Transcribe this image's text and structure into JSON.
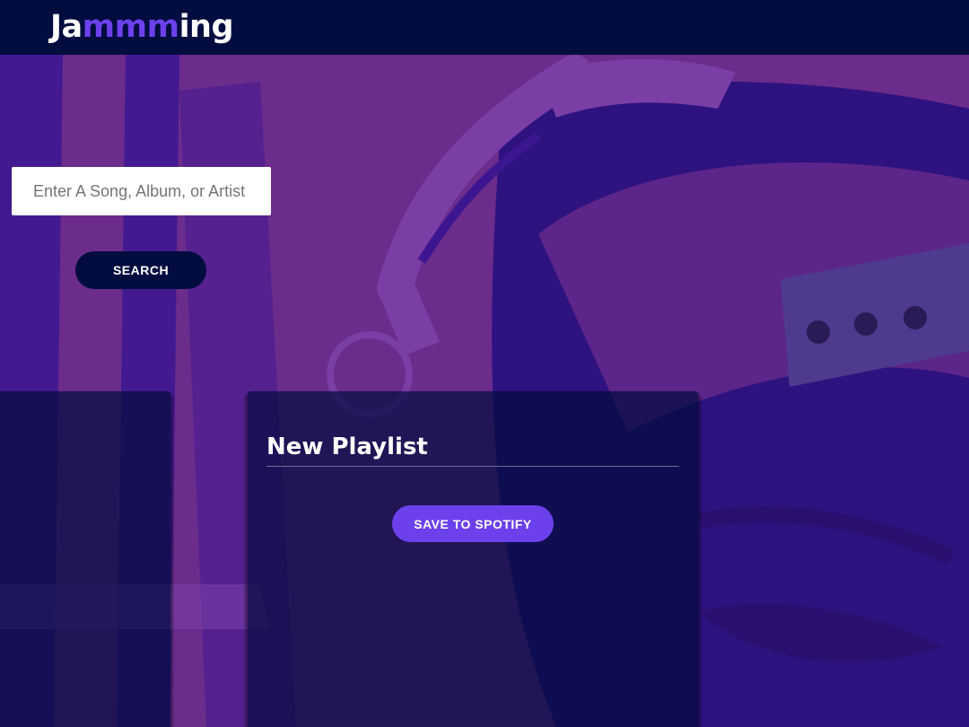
{
  "app": {
    "logo_prefix": "Ja",
    "logo_accent": "mmm",
    "logo_suffix": "ing"
  },
  "search": {
    "placeholder": "Enter A Song, Album, or Artist",
    "button_label": "SEARCH"
  },
  "playlist": {
    "name": "New Playlist",
    "save_label": "SAVE TO SPOTIFY"
  },
  "colors": {
    "header": "#010c3f",
    "accent": "#6c41ec",
    "background_purple": "#6b2c8c",
    "background_blue": "#2d127e"
  },
  "background": {
    "icon": "headphones-photo"
  }
}
